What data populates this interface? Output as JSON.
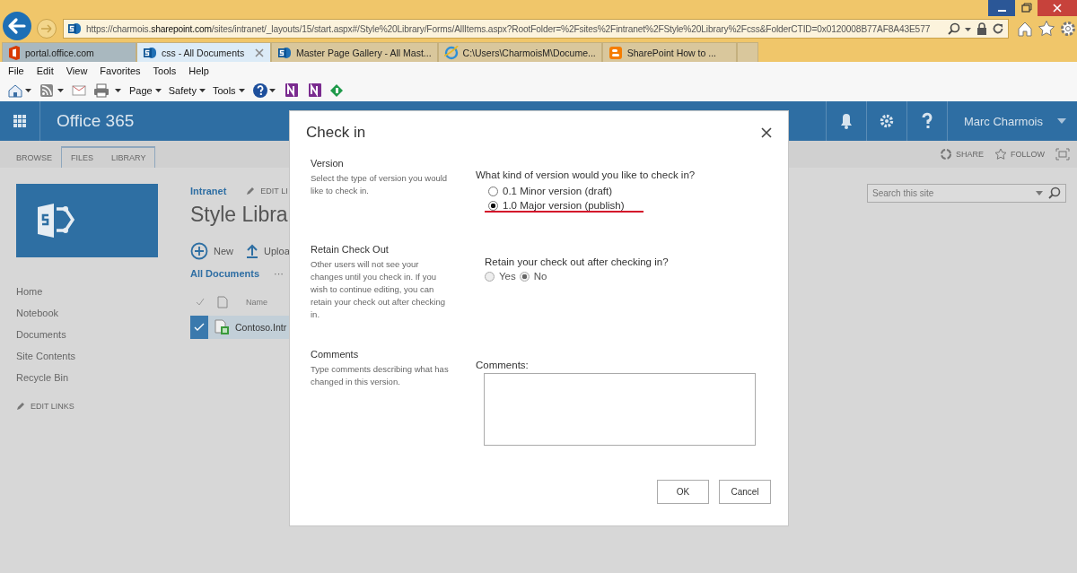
{
  "browser": {
    "address": {
      "scheme": "https://charmois.",
      "domain": "sharepoint.com",
      "path": "/sites/intranet/_layouts/15/start.aspx#/Style%20Library/Forms/AllItems.aspx?RootFolder=%2Fsites%2Fintranet%2FStyle%20Library%2Fcss&FolderCTID=0x0120008B77AF8A43E577"
    },
    "tabs": [
      {
        "label": "portal.office.com",
        "kind": "office",
        "selected": false
      },
      {
        "label": "css - All Documents",
        "kind": "sharepoint",
        "selected": true
      },
      {
        "label": "Master Page Gallery - All Mast...",
        "kind": "sharepoint",
        "selected": false
      },
      {
        "label": "C:\\Users\\CharmoisM\\Docume...",
        "kind": "ie",
        "selected": false
      },
      {
        "label": "SharePoint How to ...",
        "kind": "blogger",
        "selected": false
      }
    ],
    "menu": [
      "File",
      "Edit",
      "View",
      "Favorites",
      "Tools",
      "Help"
    ],
    "commands": [
      {
        "kind": "home"
      },
      {
        "kind": "feed"
      },
      {
        "kind": "mail"
      },
      {
        "kind": "print"
      },
      {
        "kind": "menu",
        "label": "Page"
      },
      {
        "kind": "menu",
        "label": "Safety"
      },
      {
        "kind": "menu",
        "label": "Tools"
      },
      {
        "kind": "help"
      },
      {
        "kind": "onenote"
      },
      {
        "kind": "onenote"
      },
      {
        "kind": "diamond"
      }
    ]
  },
  "suite_bar": {
    "title": "Office 365",
    "user": "Marc Charmois"
  },
  "ribbon": {
    "tabs": [
      {
        "label": "BROWSE",
        "contextual": false,
        "selected": false
      },
      {
        "label": "FILES",
        "contextual": true,
        "selected": false
      },
      {
        "label": "LIBRARY",
        "contextual": true,
        "selected": false
      }
    ],
    "actions": [
      "SHARE",
      "FOLLOW"
    ]
  },
  "search": {
    "placeholder": "Search this site"
  },
  "quick_launch": {
    "items": [
      "Home",
      "Notebook",
      "Documents",
      "Site Contents",
      "Recycle Bin"
    ],
    "edit_links": "EDIT LINKS"
  },
  "page": {
    "breadcrumb": "Intranet",
    "edit_links": "EDIT LI",
    "title": "Style Libra",
    "new": "New",
    "upload": "Uploa",
    "view": "All Documents",
    "more": "···",
    "name_column": "Name",
    "rows": [
      {
        "name": "Contoso.Intr",
        "selected": true
      }
    ]
  },
  "dialog": {
    "title": "Check in",
    "sections": [
      {
        "kind": "radios",
        "heading": "Version",
        "description": "Select the type of version you would like to check in.",
        "question": "What kind of version would you like to check in?",
        "disabled": false,
        "options": [
          {
            "label": "0.1 Minor version (draft)",
            "selected": false,
            "underlined": false
          },
          {
            "label": "1.0 Major version (publish)",
            "selected": true,
            "underlined": true
          }
        ]
      },
      {
        "kind": "inline-radios",
        "heading": "Retain Check Out",
        "description": "Other users will not see your changes until you check in. If you wish to continue editing, you can retain your check out after checking in.",
        "question": "Retain your check out after checking in?",
        "disabled": true,
        "options": [
          {
            "label": "Yes",
            "selected": false,
            "underlined": false
          },
          {
            "label": "No",
            "selected": true,
            "underlined": false
          }
        ]
      },
      {
        "kind": "textarea",
        "heading": "Comments",
        "description": "Type comments describing what has changed in this version.",
        "question": "Comments:"
      }
    ],
    "buttons": [
      "OK",
      "Cancel"
    ]
  }
}
